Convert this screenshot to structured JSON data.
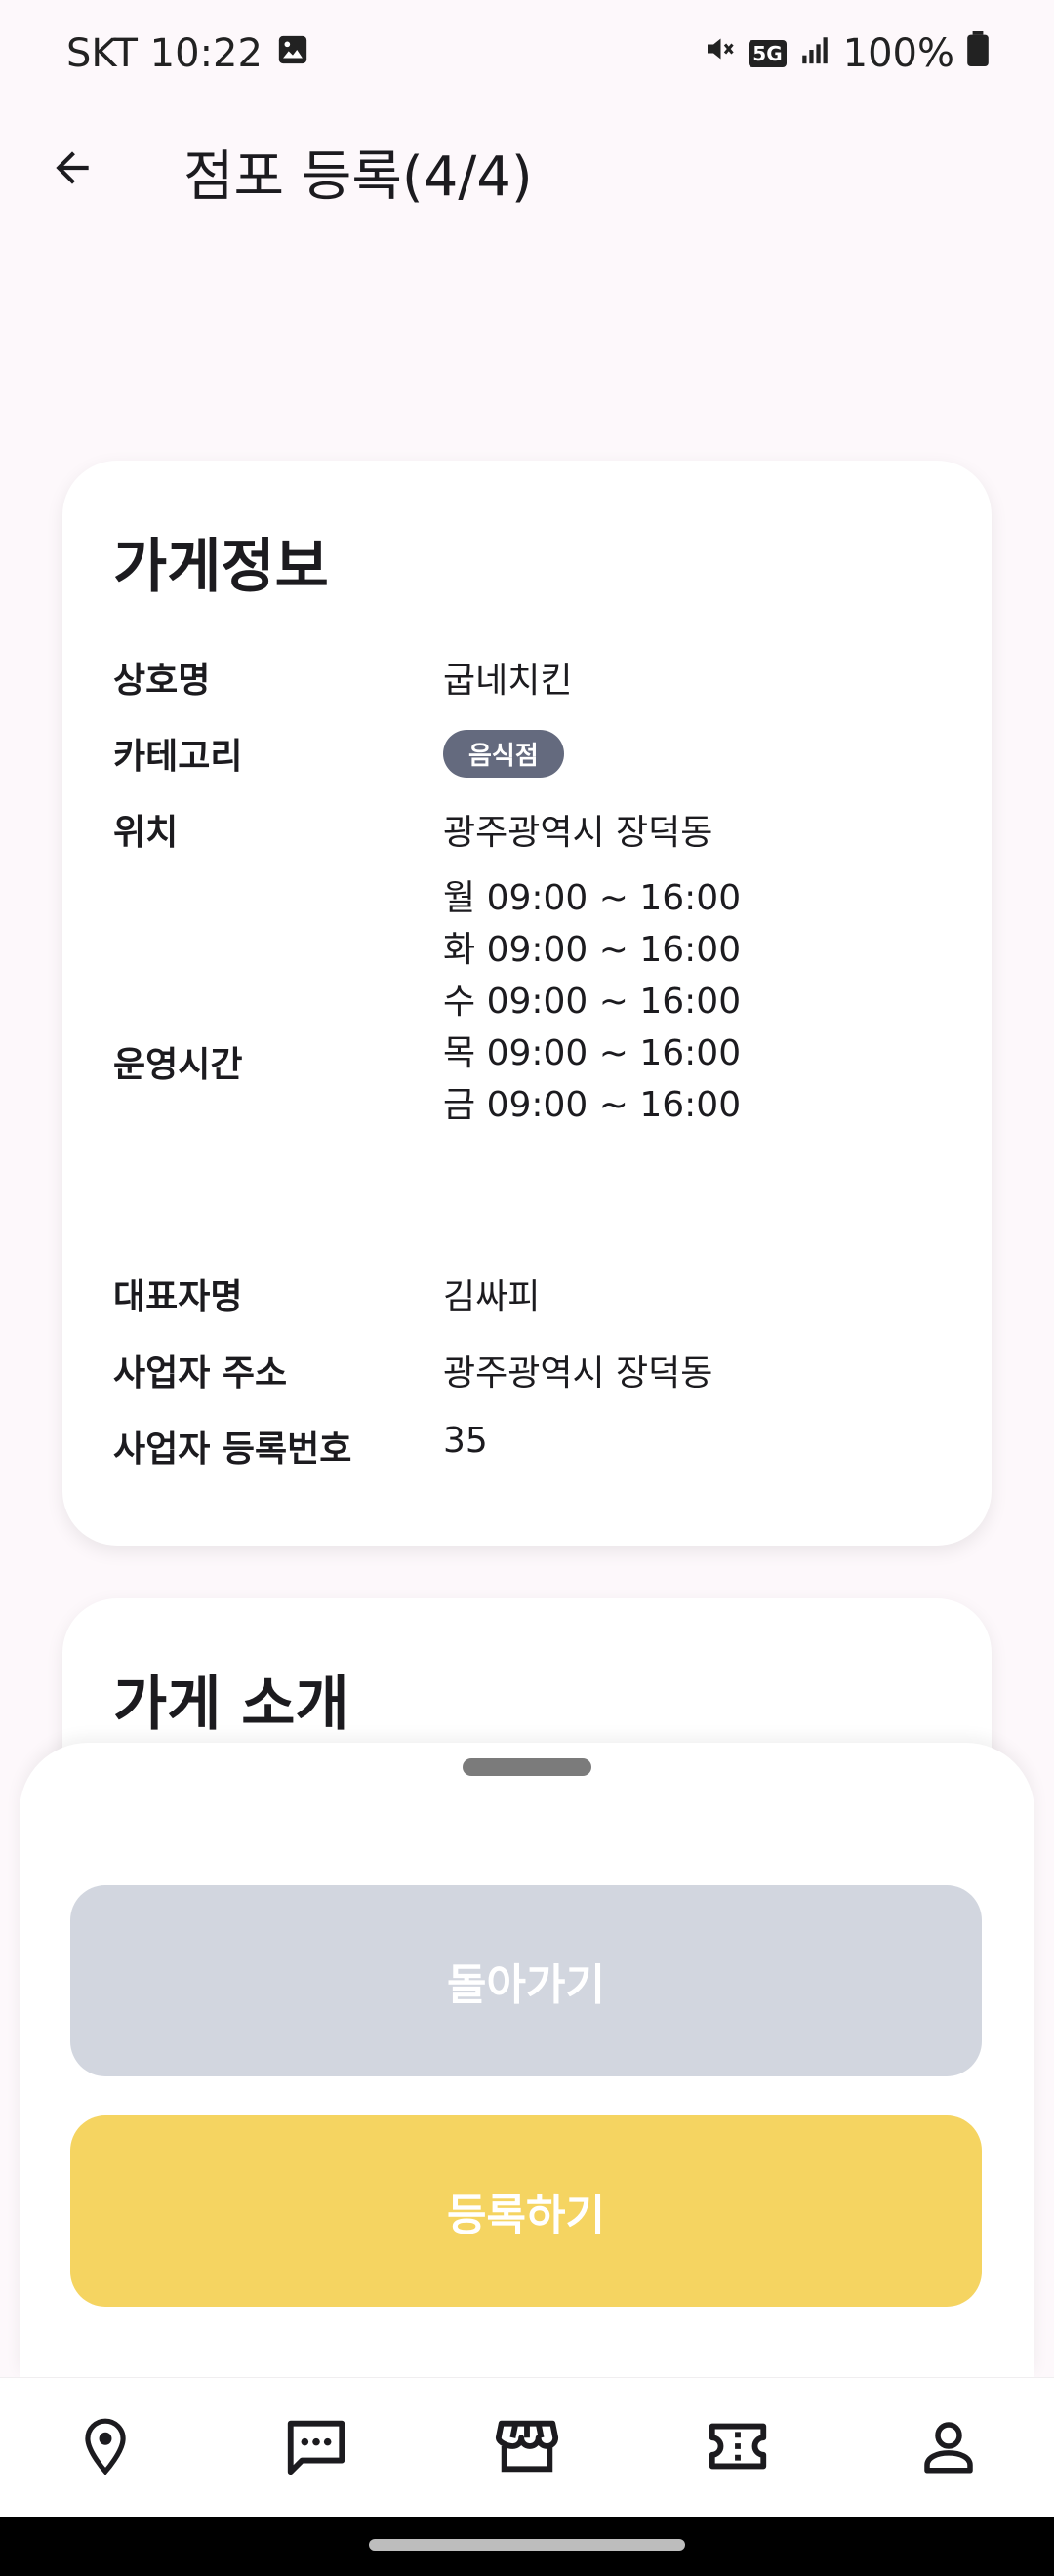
{
  "status_bar": {
    "carrier_time": "SKT 10:22",
    "network": "5G",
    "battery": "100%"
  },
  "header": {
    "title": "점포 등록(4/4)"
  },
  "store_info": {
    "title": "가게정보",
    "rows": {
      "name": {
        "label": "상호명",
        "value": "굽네치킨"
      },
      "category": {
        "label": "카테고리",
        "value": "음식점"
      },
      "location": {
        "label": "위치",
        "value": "광주광역시 장덕동"
      },
      "hours": {
        "label": "운영시간",
        "lines": [
          "월 09:00 ~ 16:00",
          "화 09:00 ~ 16:00",
          "수 09:00 ~ 16:00",
          "목 09:00 ~ 16:00",
          "금 09:00 ~ 16:00"
        ]
      },
      "owner": {
        "label": "대표자명",
        "value": "김싸피"
      },
      "business_address": {
        "label": "사업자 주소",
        "value": "광주광역시 장덕동"
      },
      "business_number": {
        "label": "사업자 등록번호",
        "value": "35"
      }
    }
  },
  "store_intro": {
    "title": "가게 소개"
  },
  "sheet": {
    "back_label": "돌아가기",
    "register_label": "등록하기"
  },
  "bottom_nav": {
    "items": [
      "location-pin-icon",
      "chat-icon",
      "store-icon",
      "ticket-icon",
      "person-icon"
    ]
  },
  "colors": {
    "primary_yellow": "#f5d461",
    "disabled_gray": "#d2d6df",
    "badge_gray": "#646a7e"
  }
}
